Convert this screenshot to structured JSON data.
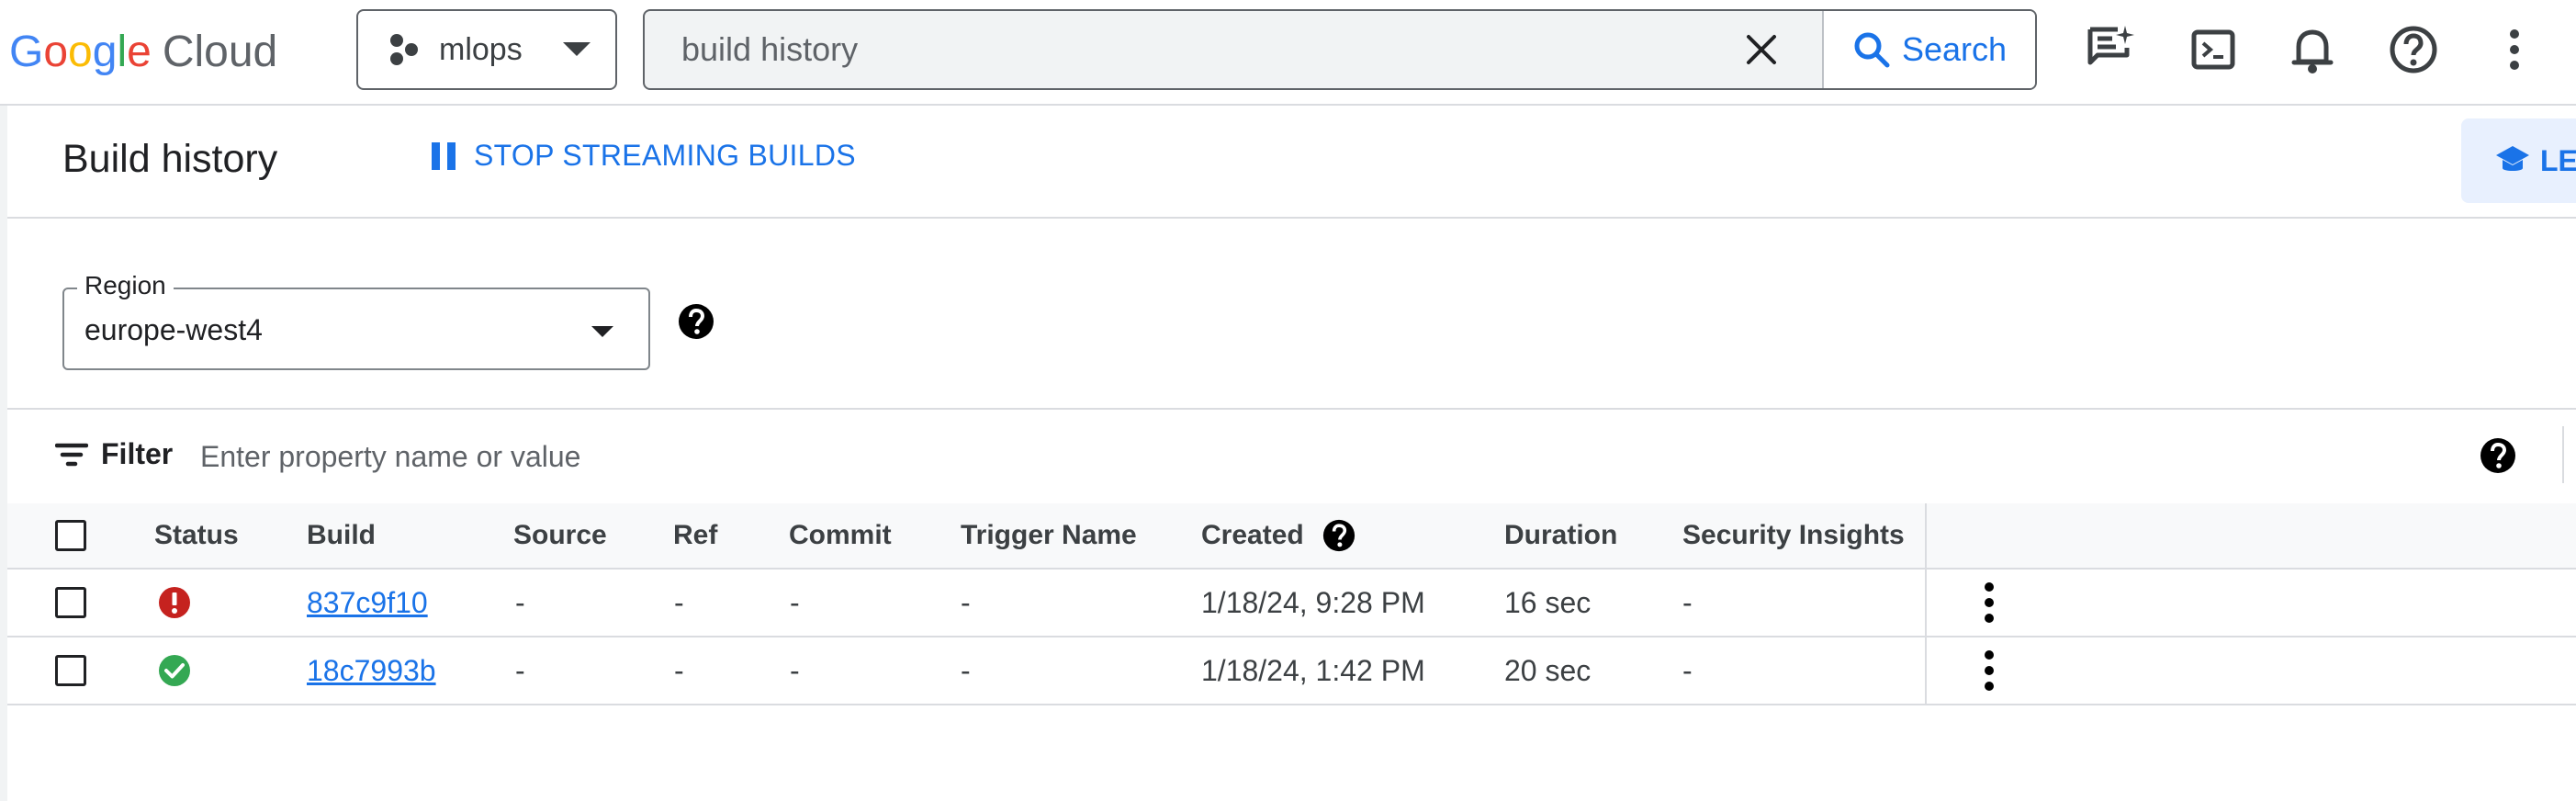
{
  "app": {
    "logo_text": "Google Cloud"
  },
  "topbar": {
    "project_name": "mlops",
    "search_value": "build history",
    "search_button_label": "Search"
  },
  "header": {
    "title": "Build history",
    "stop_streaming_label": "STOP STREAMING BUILDS",
    "learn_label": "LEA"
  },
  "region": {
    "label": "Region",
    "value": "europe-west4"
  },
  "filter": {
    "label": "Filter",
    "placeholder": "Enter property name or value"
  },
  "table": {
    "columns": [
      "Status",
      "Build",
      "Source",
      "Ref",
      "Commit",
      "Trigger Name",
      "Created",
      "Duration",
      "Security Insights"
    ],
    "rows": [
      {
        "status": "error",
        "status_icon": "error-icon",
        "build": "837c9f10",
        "source": "-",
        "ref": "-",
        "commit": "-",
        "trigger": "-",
        "created": "1/18/24, 9:28 PM",
        "duration": "16 sec",
        "security": "-"
      },
      {
        "status": "success",
        "status_icon": "success-icon",
        "build": "18c7993b",
        "source": "-",
        "ref": "-",
        "commit": "-",
        "trigger": "-",
        "created": "1/18/24, 1:42 PM",
        "duration": "20 sec",
        "security": "-"
      }
    ]
  },
  "colors": {
    "accent": "#1a73e8",
    "error": "#c5221f",
    "success": "#34a853"
  }
}
